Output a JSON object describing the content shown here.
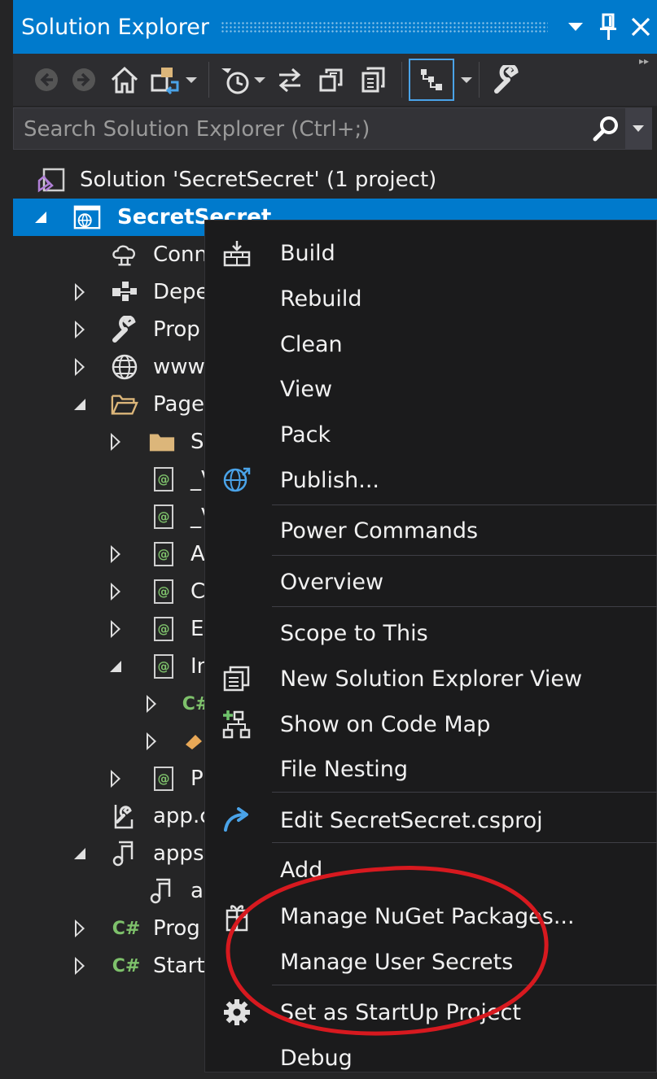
{
  "window": {
    "title": "Solution Explorer",
    "accent_color": "#007acc",
    "icons": [
      "dropdown-arrow-icon",
      "pin-icon",
      "close-icon"
    ]
  },
  "toolbar": {
    "icons": [
      "back-icon",
      "forward-icon",
      "home-icon",
      "switch-views-icon",
      "pending-changes-filter-icon",
      "sync-with-active-document-icon",
      "collapse-all-icon",
      "show-all-files-icon",
      "preview-selected-items-icon",
      "properties-icon"
    ]
  },
  "search": {
    "placeholder": "Search Solution Explorer (Ctrl+;)",
    "value": ""
  },
  "tree": {
    "solution": "Solution 'SecretSecret' (1 project)",
    "project": "SecretSecret",
    "items": [
      {
        "label": "Conn",
        "icon": "connected-services-icon"
      },
      {
        "label": "Depe",
        "icon": "dependencies-icon"
      },
      {
        "label": "Prop",
        "icon": "properties-wrench-icon"
      },
      {
        "label": "www",
        "icon": "globe-icon"
      },
      {
        "label": "Page",
        "icon": "folder-open-icon"
      },
      {
        "label": "S",
        "icon": "folder-icon"
      },
      {
        "label": "_V",
        "icon": "razor-file-icon"
      },
      {
        "label": "_V",
        "icon": "razor-file-icon"
      },
      {
        "label": "A",
        "icon": "razor-file-icon"
      },
      {
        "label": "C",
        "icon": "razor-file-icon"
      },
      {
        "label": "E",
        "icon": "razor-file-icon"
      },
      {
        "label": "In",
        "icon": "razor-file-icon"
      },
      {
        "label": "",
        "icon": "csharp-file-icon"
      },
      {
        "label": "",
        "icon": "edit-pencil-icon"
      },
      {
        "label": "P",
        "icon": "razor-file-icon"
      },
      {
        "label": "app.c",
        "icon": "config-file-icon"
      },
      {
        "label": "apps",
        "icon": "json-file-icon"
      },
      {
        "label": "a",
        "icon": "json-file-icon"
      },
      {
        "label": "Prog",
        "icon": "csharp-file-icon"
      },
      {
        "label": "Start",
        "icon": "csharp-file-icon"
      }
    ]
  },
  "context_menu": {
    "items": [
      {
        "label": "Build",
        "icon": "build-icon"
      },
      {
        "label": "Rebuild",
        "icon": ""
      },
      {
        "label": "Clean",
        "icon": ""
      },
      {
        "label": "View",
        "icon": ""
      },
      {
        "label": "Pack",
        "icon": ""
      },
      {
        "label": "Publish...",
        "icon": "publish-icon"
      },
      {
        "label": "Power Commands",
        "icon": ""
      },
      {
        "label": "Overview",
        "icon": ""
      },
      {
        "label": "Scope to This",
        "icon": ""
      },
      {
        "label": "New Solution Explorer View",
        "icon": "new-solution-explorer-view-icon"
      },
      {
        "label": "Show on Code Map",
        "icon": "code-map-icon"
      },
      {
        "label": "File Nesting",
        "icon": ""
      },
      {
        "label": "Edit SecretSecret.csproj",
        "icon": "edit-project-arrow-icon"
      },
      {
        "label": "Add",
        "icon": ""
      },
      {
        "label": "Manage NuGet Packages...",
        "icon": "nuget-package-icon"
      },
      {
        "label": "Manage User Secrets",
        "icon": ""
      },
      {
        "label": "Set as StartUp Project",
        "icon": "gear-icon"
      },
      {
        "label": "Debug",
        "icon": ""
      }
    ]
  },
  "annotation": {
    "type": "red-ellipse",
    "color": "#d7191f",
    "highlights": "Manage User Secrets"
  }
}
